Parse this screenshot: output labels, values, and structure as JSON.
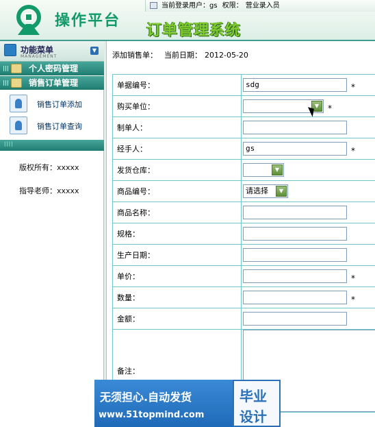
{
  "header": {
    "logo_text": "操作平台",
    "system_title": "订单管理系统",
    "user_label": "当前登录用户：",
    "user_value": "gs",
    "perm_label": "权限：",
    "perm_value": "营业录入员"
  },
  "sidebar": {
    "menu_title": "功能菜单",
    "menu_subtitle": "MANAGEMENT",
    "groups": [
      {
        "label": "个人密码管理"
      },
      {
        "label": "销售订单管理"
      }
    ],
    "items": [
      {
        "label": "销售订单添加"
      },
      {
        "label": "销售订单查询"
      }
    ],
    "copyright_label": "版权所有：",
    "copyright_value": "xxxxx",
    "teacher_label": "指导老师：",
    "teacher_value": "xxxxx"
  },
  "main": {
    "breadcrumb": "添加销售单：",
    "date_label": "当前日期：",
    "date_value": "2012-05-20",
    "fields": {
      "order_no": {
        "label": "单据编号：",
        "value": "sdg",
        "required": "*"
      },
      "buyer": {
        "label": "购买单位：",
        "value": "",
        "required": "*"
      },
      "maker": {
        "label": "制单人：",
        "value": ""
      },
      "handler": {
        "label": "经手人：",
        "value": "gs",
        "required": "*"
      },
      "warehouse": {
        "label": "发货仓库：",
        "value": ""
      },
      "product_code": {
        "label": "商品编号：",
        "value": "请选择"
      },
      "product_name": {
        "label": "商品名称：",
        "value": ""
      },
      "spec": {
        "label": "规格：",
        "value": ""
      },
      "prod_date": {
        "label": "生产日期：",
        "value": ""
      },
      "unit_price": {
        "label": "单价：",
        "value": "",
        "required": "*"
      },
      "quantity": {
        "label": "数量：",
        "value": "",
        "required": "*"
      },
      "amount": {
        "label": "金额：",
        "value": ""
      },
      "memo": {
        "label": "备注：",
        "value": ""
      }
    }
  },
  "banner": {
    "line1": "无须担心.自动发货",
    "line2": "www.51topmind.com",
    "badge_top": "毕业",
    "badge_bottom": "设计"
  },
  "colors": {
    "brand_green": "#129a6a",
    "title_green": "#7fca2e",
    "menu_teal": "#1f7c70",
    "border_cyan": "#6fc6cf"
  }
}
